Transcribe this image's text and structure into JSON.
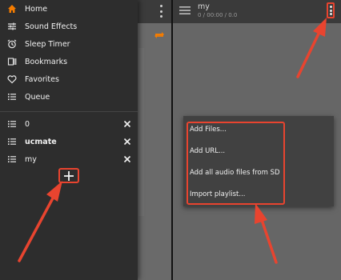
{
  "drawer": {
    "nav_items": [
      {
        "label": "Home",
        "icon": "home-icon"
      },
      {
        "label": "Sound Effects",
        "icon": "equalizer-icon"
      },
      {
        "label": "Sleep Timer",
        "icon": "alarm-icon"
      },
      {
        "label": "Bookmarks",
        "icon": "bookmark-icon"
      },
      {
        "label": "Favorites",
        "icon": "heart-icon"
      },
      {
        "label": "Queue",
        "icon": "queue-icon"
      }
    ],
    "playlists": [
      {
        "label": "0",
        "icon": "playlist-icon"
      },
      {
        "label": "ucmate",
        "icon": "playlist-icon"
      },
      {
        "label": "my",
        "icon": "playlist-icon"
      }
    ],
    "add_playlist_icon": "plus-icon"
  },
  "player": {
    "title": "my",
    "subtitle": "0 / 00:00 / 0.0"
  },
  "menu": {
    "items": [
      "Add Files...",
      "Add URL...",
      "Add all audio files from SD",
      "Import playlist..."
    ]
  },
  "colors": {
    "accent": "#f57c00",
    "annotation": "#e8442f",
    "drawer_bg": "#2d2d2d",
    "topbar_bg": "#3a3a3a",
    "menu_bg": "#414141"
  }
}
